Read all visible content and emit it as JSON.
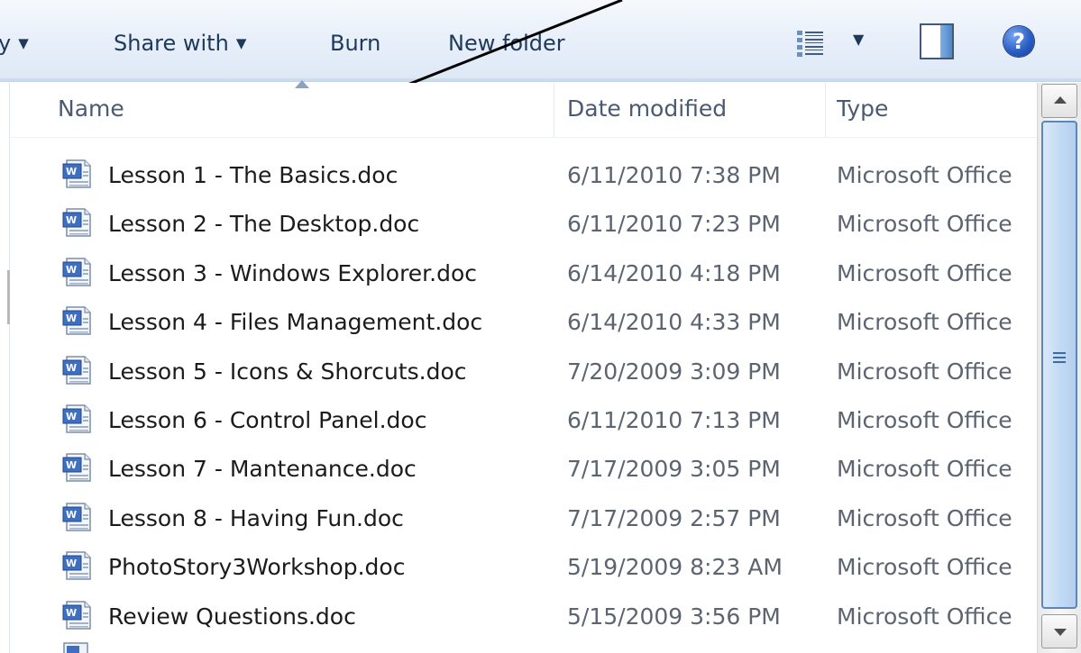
{
  "toolbar": {
    "library_partial": "y",
    "share_with": "Share with",
    "burn": "Burn",
    "new_folder": "New folder"
  },
  "icons": {
    "library": "chevron-down-icon",
    "share": "chevron-down-icon",
    "views": "view-details-icon",
    "preview_pane": "preview-pane-icon",
    "help": "help-icon",
    "file": "word-document-icon"
  },
  "header": {
    "name": "Name",
    "date_modified": "Date modified",
    "type": "Type",
    "sort": "ascending"
  },
  "files": [
    {
      "name": "Lesson 1 - The Basics.doc",
      "date": "6/11/2010 7:38 PM",
      "type": "Microsoft Office"
    },
    {
      "name": "Lesson 2 - The Desktop.doc",
      "date": "6/11/2010 7:23 PM",
      "type": "Microsoft Office"
    },
    {
      "name": "Lesson 3 - Windows Explorer.doc",
      "date": "6/14/2010 4:18 PM",
      "type": "Microsoft Office"
    },
    {
      "name": "Lesson 4 - Files Management.doc",
      "date": "6/14/2010 4:33 PM",
      "type": "Microsoft Office"
    },
    {
      "name": "Lesson 5 - Icons & Shorcuts.doc",
      "date": "7/20/2009 3:09 PM",
      "type": "Microsoft Office"
    },
    {
      "name": "Lesson 6 - Control Panel.doc",
      "date": "6/11/2010 7:13 PM",
      "type": "Microsoft Office"
    },
    {
      "name": "Lesson 7 - Mantenance.doc",
      "date": "7/17/2009 3:05 PM",
      "type": "Microsoft Office"
    },
    {
      "name": "Lesson 8 - Having Fun.doc",
      "date": "7/17/2009 2:57 PM",
      "type": "Microsoft Office"
    },
    {
      "name": "PhotoStory3Workshop.doc",
      "date": "5/19/2009 8:23 AM",
      "type": "Microsoft Office"
    },
    {
      "name": "Review Questions.doc",
      "date": "5/15/2009 3:56 PM",
      "type": "Microsoft Office"
    }
  ],
  "colors": {
    "toolbar_text": "#1e395b",
    "header_text": "#4a5a72",
    "secondary_text": "#5c6470",
    "scroll_thumb_border": "#5e86b8",
    "help_blue": "#2b5fc5"
  }
}
